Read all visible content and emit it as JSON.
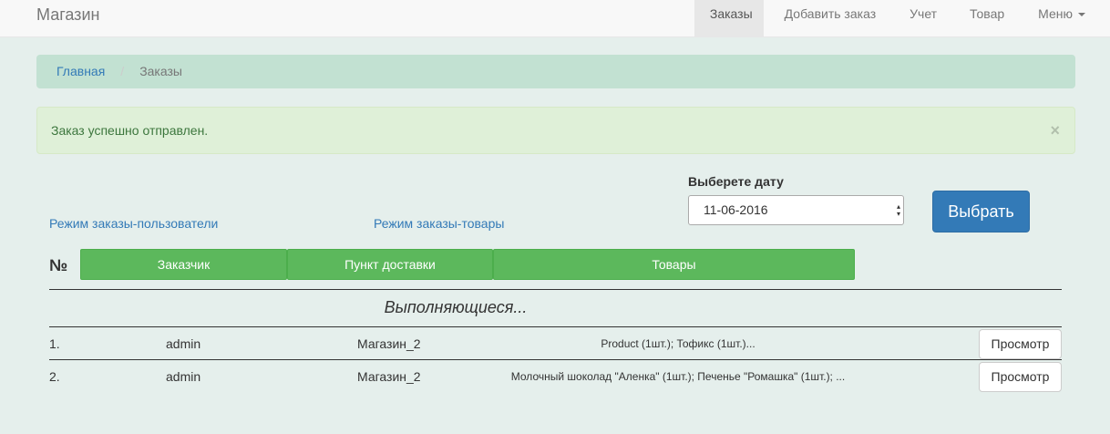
{
  "navbar": {
    "brand": "Магазин",
    "items": [
      {
        "label": "Заказы",
        "active": true
      },
      {
        "label": "Добавить заказ",
        "active": false
      },
      {
        "label": "Учет",
        "active": false
      },
      {
        "label": "Товар",
        "active": false
      },
      {
        "label": "Меню",
        "active": false
      }
    ]
  },
  "breadcrumb": {
    "home": "Главная",
    "separator": "/",
    "current": "Заказы"
  },
  "alert": {
    "message": "Заказ успешно отправлен.",
    "close": "×"
  },
  "filter": {
    "label": "Выберете дату",
    "date_value": "11-06-2016",
    "submit": "Выбрать"
  },
  "modes": {
    "users": "Режим заказы-пользователи",
    "goods": "Режим заказы-товары"
  },
  "table": {
    "headers": {
      "number": "№",
      "customer": "Заказчик",
      "delivery": "Пункт доставки",
      "goods": "Товары"
    },
    "section_title": "Выполняющиеся...",
    "rows": [
      {
        "num": "1.",
        "customer": "admin",
        "delivery": "Магазин_2",
        "goods": "Product (1шт.); Тофикс (1шт.)...",
        "action": "Просмотр"
      },
      {
        "num": "2.",
        "customer": "admin",
        "delivery": "Магазин_2",
        "goods": "Молочный шоколад \"Аленка\" (1шт.); Печенье \"Ромашка\" (1шт.); ...",
        "action": "Просмотр"
      }
    ]
  },
  "colors": {
    "accent": "#337ab7",
    "header_button": "#5cb85c",
    "alert_bg": "#dff0d8",
    "breadcrumb_bg": "#c2e1d2",
    "page_bg": "#e5efec"
  }
}
